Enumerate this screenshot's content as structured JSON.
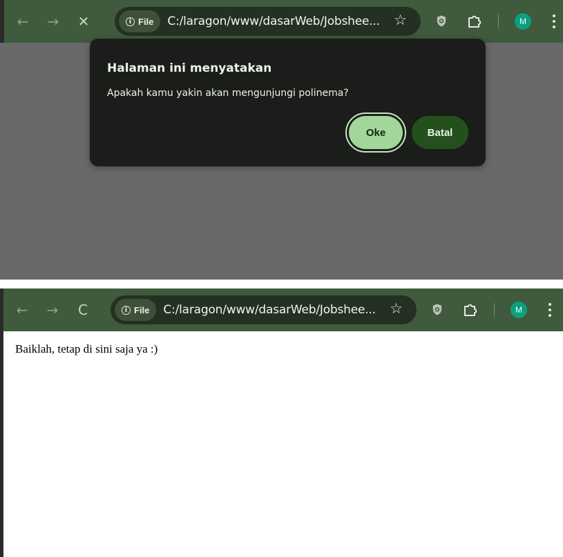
{
  "screenshot_1": {
    "toolbar": {
      "back_icon": "←",
      "forward_icon": "→",
      "stop_icon": "✕",
      "file_chip_label": "File",
      "info_icon": "i",
      "url": "C:/laragon/www/dasarWeb/Jobshee...",
      "bookmark_icon": "☆",
      "avatar_initial": "M"
    },
    "dialog": {
      "title": "Halaman ini menyatakan",
      "message": "Apakah kamu yakin akan mengunjungi polinema?",
      "ok_label": "Oke",
      "cancel_label": "Batal"
    }
  },
  "screenshot_2": {
    "toolbar": {
      "back_icon": "←",
      "forward_icon": "→",
      "reload_icon": "C",
      "file_chip_label": "File",
      "info_icon": "i",
      "url": "C:/laragon/www/dasarWeb/Jobshee...",
      "bookmark_icon": "☆",
      "avatar_initial": "M"
    },
    "page": {
      "body_text": "Baiklah, tetap di sini saja ya :)"
    }
  },
  "colors": {
    "toolbar_bg": "#3f5a3c",
    "omnibox_bg": "#243122",
    "dialog_bg": "#1b1d1a",
    "ok_button_bg": "#a3d69a",
    "cancel_button_bg": "#24501e",
    "avatar_bg": "#0c9f7f",
    "scrim": "#696969"
  }
}
